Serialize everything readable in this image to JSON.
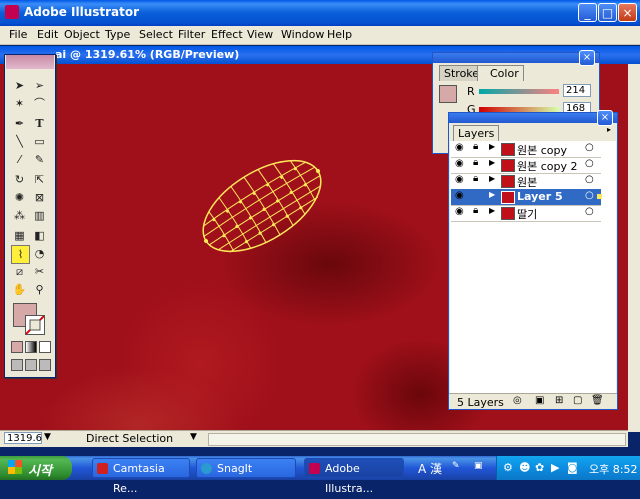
{
  "app": {
    "title": "Adobe Illustrator"
  },
  "menu": [
    "File",
    "Edit",
    "Object",
    "Type",
    "Select",
    "Filter",
    "Effect",
    "View",
    "Window",
    "Help"
  ],
  "document": {
    "title": "ai @ 1319.61% (RGB/Preview)"
  },
  "color_panel": {
    "tabs": [
      "Stroke",
      "Color"
    ],
    "r_label": "R",
    "r_value": "214",
    "g_label": "G",
    "g_value": "168",
    "fill_color": "#d6a8a8"
  },
  "layers_panel": {
    "tab": "Layers",
    "rows": [
      {
        "name": "원본 copy"
      },
      {
        "name": "원본 copy 2"
      },
      {
        "name": "원본"
      },
      {
        "name": "Layer 5"
      },
      {
        "name": "딸기"
      }
    ],
    "footer": "5 Layers"
  },
  "status": {
    "zoom": "1319.6",
    "tool": "Direct Selection"
  },
  "taskbar": {
    "start": "시작",
    "tasks": [
      "Camtasia Re...",
      "SnagIt",
      "Adobe Illustra..."
    ],
    "ime": "A 漢",
    "clock": "오후 8:52"
  },
  "colors": {
    "canvas": "#a0101a",
    "mesh": "#ffe85a",
    "selection": "#316ac5"
  }
}
